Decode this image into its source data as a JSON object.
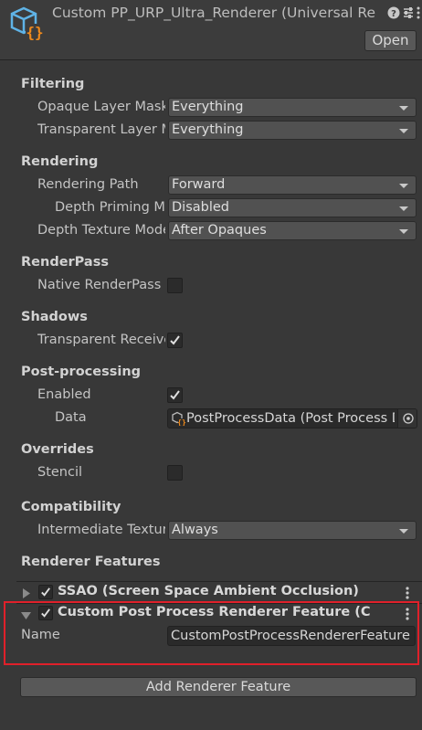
{
  "header": {
    "title": "Custom PP_URP_Ultra_Renderer (Universal Re",
    "open_label": "Open",
    "icons": [
      "renderer-asset-icon",
      "help-icon",
      "settings-sliders-icon",
      "kebab-menu-icon"
    ]
  },
  "filtering": {
    "section": "Filtering",
    "opaque_label": "Opaque Layer Mask",
    "opaque_value": "Everything",
    "transparent_label": "Transparent Layer Mask",
    "transparent_value": "Everything"
  },
  "rendering": {
    "section": "Rendering",
    "path_label": "Rendering Path",
    "path_value": "Forward",
    "depth_priming_label": "Depth Priming Mode",
    "depth_priming_value": "Disabled",
    "depth_texture_label": "Depth Texture Mode",
    "depth_texture_value": "After Opaques"
  },
  "renderpass": {
    "section": "RenderPass",
    "native_label": "Native RenderPass",
    "native_checked": false
  },
  "shadows": {
    "section": "Shadows",
    "transparent_label": "Transparent Receive Shadows",
    "transparent_checked": true
  },
  "postprocessing": {
    "section": "Post-processing",
    "enabled_label": "Enabled",
    "enabled_checked": true,
    "data_label": "Data",
    "data_value": "PostProcessData (Post Process Data)"
  },
  "overrides": {
    "section": "Overrides",
    "stencil_label": "Stencil",
    "stencil_checked": false
  },
  "compatibility": {
    "section": "Compatibility",
    "intermediate_label": "Intermediate Texture",
    "intermediate_value": "Always"
  },
  "renderer_features": {
    "section": "Renderer Features",
    "features": [
      {
        "title": "SSAO (Screen Space Ambient Occlusion)",
        "enabled": true,
        "expanded": false
      },
      {
        "title": "Custom Post Process Renderer Feature (Custom Post Process Renderer Feature)",
        "enabled": true,
        "expanded": true,
        "name_label": "Name",
        "name_value": "CustomPostProcessRendererFeature"
      }
    ],
    "add_label": "Add Renderer Feature"
  },
  "colors": {
    "highlight": "#e0202a",
    "background": "#383838",
    "header": "#3c3c3c"
  }
}
